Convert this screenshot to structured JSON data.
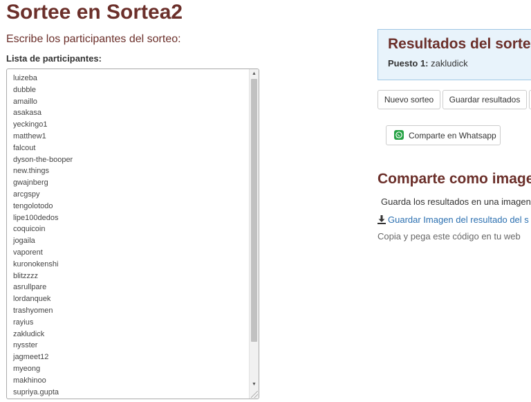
{
  "header": {
    "title": "Sortee en Sortea2",
    "subtitle": "Escribe los participantes del sorteo:",
    "list_label": "Lista de participantes:"
  },
  "participants": [
    "luizeba",
    "dubble",
    "amaillo",
    "asakasa",
    "yeckingo1",
    "matthew1",
    "falcout",
    "dyson-the-booper",
    "new.things",
    "gwajnberg",
    "arcgspy",
    "tengolotodo",
    "lipe100dedos",
    "coquicoin",
    "jogaila",
    "vaporent",
    "kuronokenshi",
    "blitzzzz",
    "asrullpare",
    "lordanquek",
    "trashyomen",
    "rayius",
    "zakludick",
    "nysster",
    "jagmeet12",
    "myeong",
    "makhinoo",
    "supriya.gupta"
  ],
  "results": {
    "title": "Resultados del sorteo",
    "position_label": "Puesto 1:",
    "winner": "zakludick"
  },
  "actions": {
    "new_label": "Nuevo sorteo",
    "save_label": "Guardar resultados",
    "whatsapp_label": "Comparte en Whatsapp"
  },
  "share": {
    "title": "Comparte como imagen",
    "description": "Guarda los resultados en una imagen",
    "download_label": "Guardar Imagen del resultado del s",
    "copy_text": "Copia y pega este código en tu web"
  },
  "colors": {
    "title": "#6b2f2a",
    "results_bg": "#e8f3fb",
    "results_border": "#9fc7e4",
    "link": "#2a6fb0",
    "whatsapp": "#25a244"
  }
}
